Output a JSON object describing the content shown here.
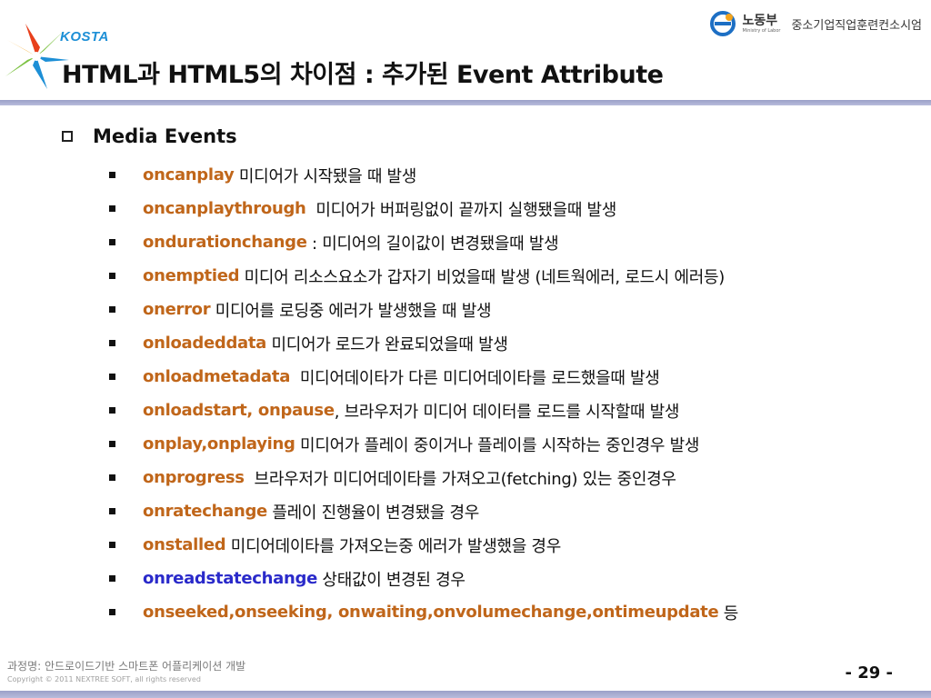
{
  "header": {
    "logo_text": "KOSTA",
    "ministry_name": "노동부",
    "ministry_en": "Ministry of Labor",
    "training_center": "중소기업직업훈련컨소시엄"
  },
  "title": "HTML과 HTML5의 차이점 : 추가된 Event Attribute",
  "section": {
    "label": "Media Events"
  },
  "events": [
    {
      "name": "oncanplay",
      "desc": " 미디어가 시작됐을 때 발생",
      "color": "#c0661a"
    },
    {
      "name": "oncanplaythrough",
      "desc": "  미디어가 버퍼링없이 끝까지 실행됐을때 발생",
      "color": "#c0661a"
    },
    {
      "name": "ondurationchange",
      "desc": " : 미디어의 길이값이 변경됐을때 발생",
      "color": "#c0661a"
    },
    {
      "name": "onemptied",
      "desc": " 미디어 리소스요소가 갑자기 비었을때 발생 (네트웍에러, 로드시 에러등)",
      "color": "#c0661a"
    },
    {
      "name": "onerror",
      "desc": " 미디어를 로딩중 에러가 발생했을 때 발생",
      "color": "#c0661a"
    },
    {
      "name": "onloadeddata",
      "desc": " 미디어가 로드가 완료되었을때 발생",
      "color": "#c0661a"
    },
    {
      "name": "onloadmetadata",
      "desc": "  미디어데이타가 다른 미디어데이타를 로드했을때 발생",
      "color": "#c0661a"
    },
    {
      "name": "onloadstart, onpause",
      "desc": ", 브라우저가 미디어 데이터를 로드를 시작할때 발생",
      "color": "#c0661a"
    },
    {
      "name": "onplay,onplaying",
      "desc": " 미디어가 플레이 중이거나 플레이를 시작하는 중인경우 발생",
      "color": "#c0661a"
    },
    {
      "name": "onprogress",
      "desc": "  브라우저가 미디어데이타를 가져오고(fetching) 있는 중인경우",
      "color": "#c0661a"
    },
    {
      "name": "onratechange",
      "desc": " 플레이 진행율이 변경됐을 경우",
      "color": "#c0661a"
    },
    {
      "name": "onstalled",
      "desc": " 미디어데이타를 가져오는중 에러가 발생했을 경우",
      "color": "#c0661a"
    },
    {
      "name": "onreadstatechange",
      "desc": " 상태값이 변경된 경우",
      "color": "#2a2aca"
    },
    {
      "name": "onseeked,onseeking, onwaiting,onvolumechange,ontimeupdate",
      "desc": " 등",
      "color": "#c0661a"
    }
  ],
  "footer": {
    "course": "과정명: 안드로이드기반 스마트폰 어플리케이션 개발",
    "copyright": "Copyright © 2011 NEXTREE SOFT, all rights reserved",
    "page": "- 29 -"
  }
}
